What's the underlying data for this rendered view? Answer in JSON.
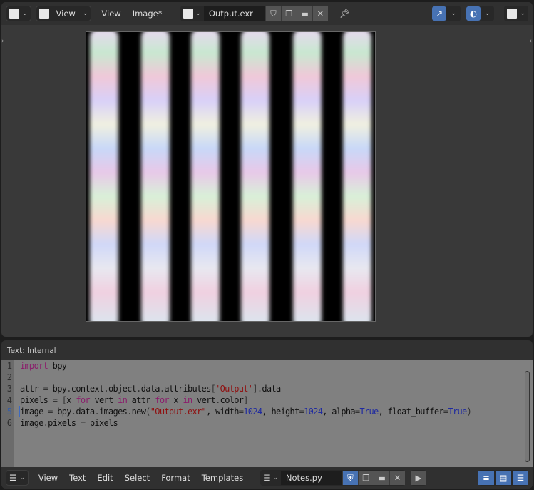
{
  "image_editor": {
    "header": {
      "editor_type_icon": "image-editor-icon",
      "mode_label": "View",
      "menus": [
        "View",
        "Image*"
      ],
      "image_browse_icon": "image-icon",
      "image_name": "Output.exr",
      "fake_user_icon": "shield-icon",
      "duplicate_icon": "duplicate-icon",
      "open_icon": "folder-icon",
      "unlink_icon": "close-icon",
      "pin_icon": "pin-icon",
      "gizmo_icon": "gizmo-icon",
      "overlay_icon": "overlay-icon",
      "display_channels_icon": "display-channels-icon"
    }
  },
  "text_editor": {
    "title": "Text: Internal",
    "line_numbers": [
      "1",
      "2",
      "3",
      "4",
      "5",
      "6"
    ],
    "current_line": 5,
    "code": [
      [
        [
          "import",
          "k"
        ],
        [
          " bpy",
          ""
        ]
      ],
      [],
      [
        [
          "attr ",
          ""
        ],
        [
          "=",
          "p"
        ],
        [
          " bpy",
          ""
        ],
        [
          ".",
          "p"
        ],
        [
          "context",
          ""
        ],
        [
          ".",
          "p"
        ],
        [
          "object",
          ""
        ],
        [
          ".",
          "p"
        ],
        [
          "data",
          ""
        ],
        [
          ".",
          "p"
        ],
        [
          "attributes",
          ""
        ],
        [
          "[",
          "p"
        ],
        [
          "'Output'",
          "s"
        ],
        [
          "]",
          "p"
        ],
        [
          ".",
          "p"
        ],
        [
          "data",
          ""
        ]
      ],
      [
        [
          "pixels ",
          ""
        ],
        [
          "=",
          "p"
        ],
        [
          " ",
          ""
        ],
        [
          "[",
          "p"
        ],
        [
          "x ",
          ""
        ],
        [
          "for",
          "k"
        ],
        [
          " vert ",
          ""
        ],
        [
          "in",
          "k"
        ],
        [
          " attr ",
          ""
        ],
        [
          "for",
          "k"
        ],
        [
          " x ",
          ""
        ],
        [
          "in",
          "k"
        ],
        [
          " vert",
          ""
        ],
        [
          ".",
          "p"
        ],
        [
          "color",
          ""
        ],
        [
          "]",
          "p"
        ]
      ],
      [
        [
          "image ",
          ""
        ],
        [
          "=",
          "p"
        ],
        [
          " bpy",
          ""
        ],
        [
          ".",
          "p"
        ],
        [
          "data",
          ""
        ],
        [
          ".",
          "p"
        ],
        [
          "images",
          ""
        ],
        [
          ".",
          "p"
        ],
        [
          "new",
          ""
        ],
        [
          "(",
          "p"
        ],
        [
          "\"Output.exr\"",
          "s"
        ],
        [
          ", width",
          ""
        ],
        [
          "=",
          "p"
        ],
        [
          "1024",
          "n"
        ],
        [
          ", height",
          ""
        ],
        [
          "=",
          "p"
        ],
        [
          "1024",
          "n"
        ],
        [
          ", alpha",
          ""
        ],
        [
          "=",
          "p"
        ],
        [
          "True",
          "n"
        ],
        [
          ", float_buffer",
          ""
        ],
        [
          "=",
          "p"
        ],
        [
          "True",
          "n"
        ],
        [
          ")",
          "p"
        ]
      ],
      [
        [
          "image",
          ""
        ],
        [
          ".",
          "p"
        ],
        [
          "pixels ",
          ""
        ],
        [
          "=",
          "p"
        ],
        [
          " pixels",
          ""
        ]
      ]
    ],
    "footer": {
      "menus": [
        "View",
        "Text",
        "Edit",
        "Select",
        "Format",
        "Templates"
      ],
      "text_name": "Notes.py",
      "run_icon": "play-icon"
    }
  },
  "colors": {
    "accent": "#4772b3",
    "code_bg": "#808080",
    "keyword": "#8b1b6b",
    "string": "#8f1010",
    "number": "#1f2aa0"
  }
}
